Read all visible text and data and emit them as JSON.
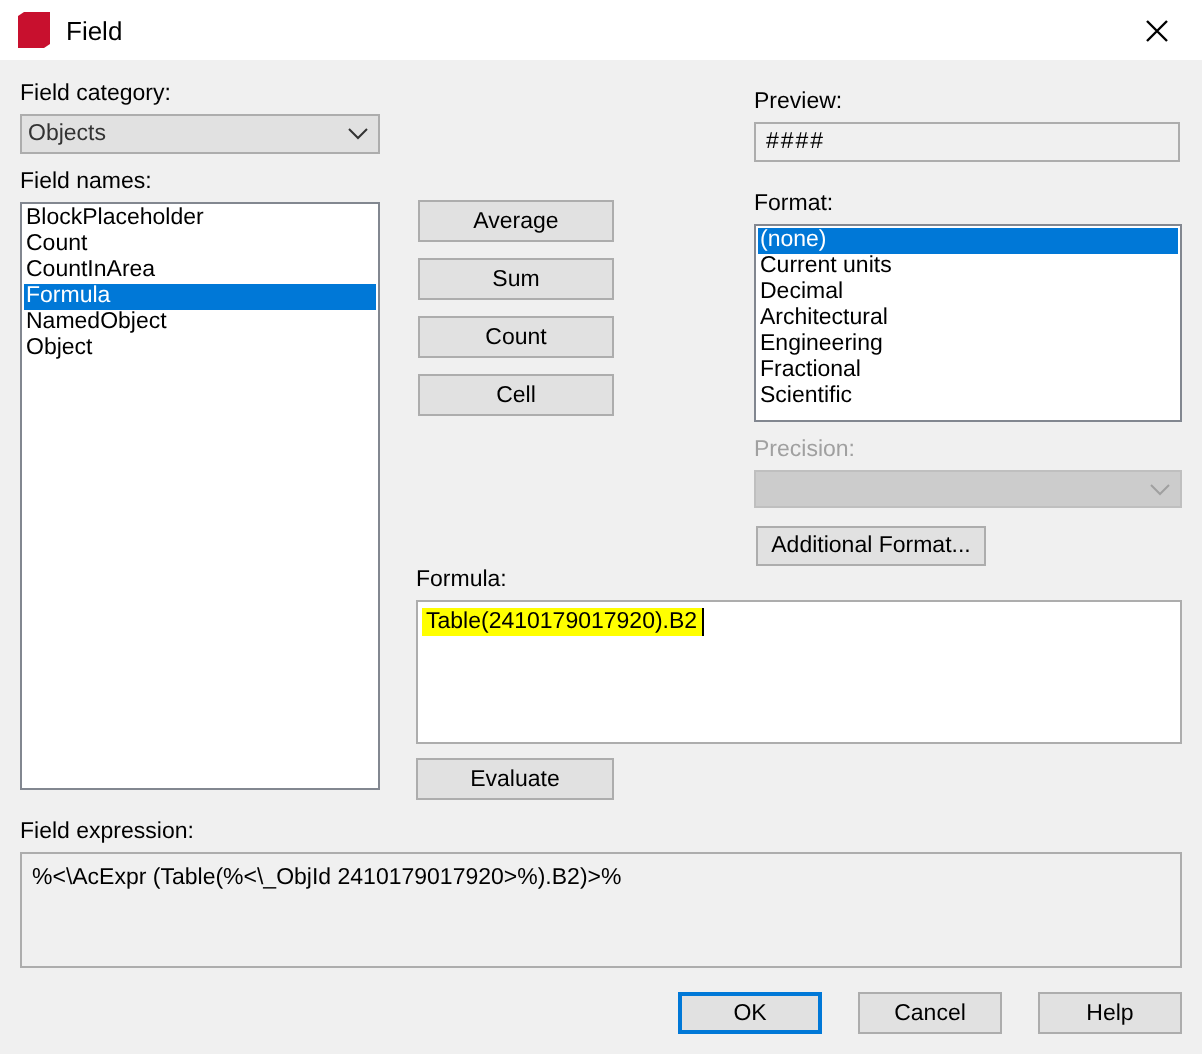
{
  "window": {
    "title": "Field"
  },
  "field_category": {
    "label": "Field category:",
    "value": "Objects"
  },
  "field_names": {
    "label": "Field names:",
    "items": [
      {
        "label": "BlockPlaceholder",
        "selected": false
      },
      {
        "label": "Count",
        "selected": false
      },
      {
        "label": "CountInArea",
        "selected": false
      },
      {
        "label": "Formula",
        "selected": true
      },
      {
        "label": "NamedObject",
        "selected": false
      },
      {
        "label": "Object",
        "selected": false
      }
    ]
  },
  "function_buttons": [
    "Average",
    "Sum",
    "Count",
    "Cell"
  ],
  "preview": {
    "label": "Preview:",
    "value": "####"
  },
  "format": {
    "label": "Format:",
    "items": [
      {
        "label": "(none)",
        "selected": true
      },
      {
        "label": "Current units",
        "selected": false
      },
      {
        "label": "Decimal",
        "selected": false
      },
      {
        "label": "Architectural",
        "selected": false
      },
      {
        "label": "Engineering",
        "selected": false
      },
      {
        "label": "Fractional",
        "selected": false
      },
      {
        "label": "Scientific",
        "selected": false
      }
    ]
  },
  "precision": {
    "label": "Precision:",
    "disabled": true
  },
  "additional_format_button": "Additional Format...",
  "formula": {
    "label": "Formula:",
    "value": "Table(2410179017920).B2",
    "highlighted": true
  },
  "evaluate_button": "Evaluate",
  "field_expression": {
    "label": "Field expression:",
    "value": "%<\\AcExpr (Table(%<\\_ObjId 2410179017920>%).B2)>%"
  },
  "buttons": [
    {
      "label": "OK",
      "default": true
    },
    {
      "label": "Cancel",
      "default": false
    },
    {
      "label": "Help",
      "default": false
    }
  ]
}
